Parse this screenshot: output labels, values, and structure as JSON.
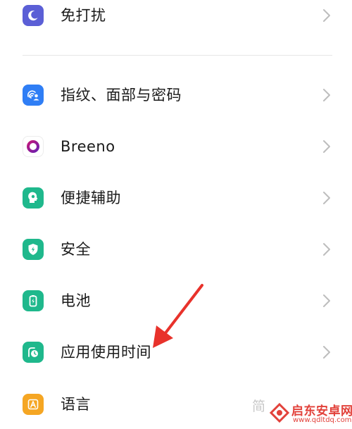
{
  "settings": {
    "items": [
      {
        "label": "免打扰",
        "icon": "moon-icon",
        "color": "#5b5fd6"
      },
      {
        "label": "指纹、面部与密码",
        "icon": "fingerprint-face-icon",
        "color": "#2f7ef5"
      },
      {
        "label": "Breeno",
        "icon": "breeno-ring-icon",
        "color": "#ffffff"
      },
      {
        "label": "便捷辅助",
        "icon": "assist-head-icon",
        "color": "#1fb88c"
      },
      {
        "label": "安全",
        "icon": "shield-icon",
        "color": "#1fb88c"
      },
      {
        "label": "电池",
        "icon": "battery-icon",
        "color": "#1fb88c"
      },
      {
        "label": "应用使用时间",
        "icon": "app-usage-time-icon",
        "color": "#1fb88c"
      },
      {
        "label": "语言",
        "icon": "language-a-icon",
        "color": "#f5a623"
      }
    ]
  },
  "overlay": {
    "arrow_color": "#e8322b",
    "ghost_text": "简"
  },
  "watermark": {
    "title": "启东安卓网",
    "url": "www.qdltdq.com",
    "color": "#e2413a"
  }
}
